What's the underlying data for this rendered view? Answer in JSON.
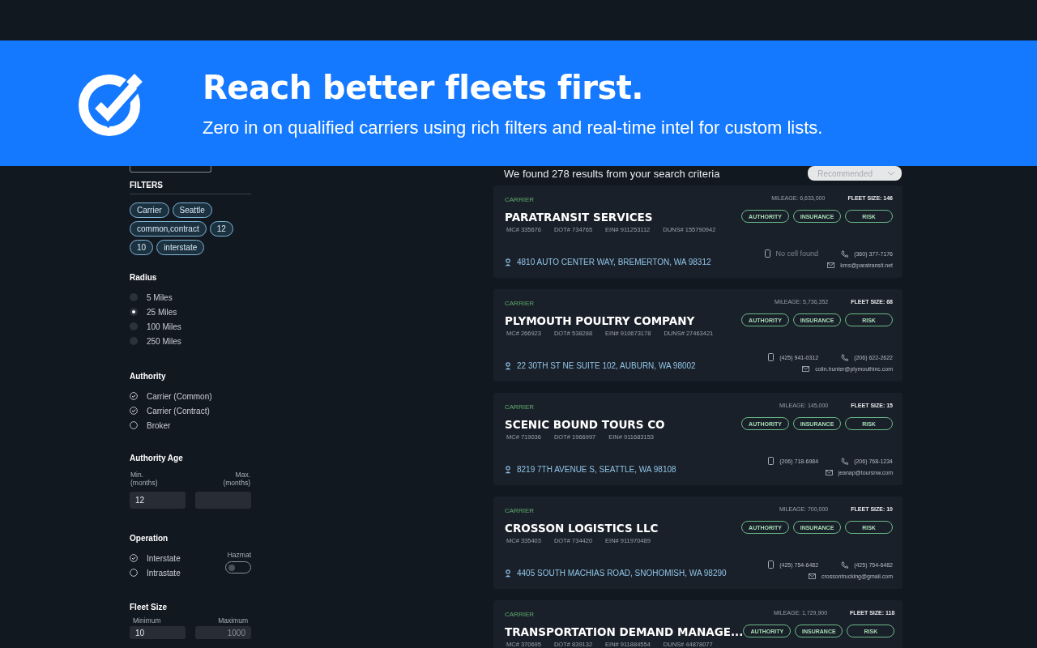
{
  "banner": {
    "title": "Reach better fleets first.",
    "subtitle": "Zero in on qualified carriers using rich filters and real-time intel for custom lists."
  },
  "sidebar": {
    "filters_title": "FILTERS",
    "chips": [
      "Carrier",
      "Seattle",
      "common,contract",
      "12",
      "10",
      "interstate"
    ],
    "radius": {
      "title": "Radius",
      "options": [
        {
          "label": "5 Miles",
          "selected": false
        },
        {
          "label": "25 Miles",
          "selected": true
        },
        {
          "label": "100 Miles",
          "selected": false
        },
        {
          "label": "250 Miles",
          "selected": false
        }
      ]
    },
    "authority": {
      "title": "Authority",
      "options": [
        {
          "label": "Carrier (Common)",
          "checked": true
        },
        {
          "label": "Carrier (Contract)",
          "checked": true
        },
        {
          "label": "Broker",
          "checked": false
        }
      ]
    },
    "authority_age": {
      "title": "Authority Age",
      "min_label": "Min.\n(months)",
      "max_label": "Max.\n(months)",
      "min_value": "12"
    },
    "operation": {
      "title": "Operation",
      "options": [
        {
          "label": "Interstate",
          "checked": true
        },
        {
          "label": "Intrastate",
          "checked": false
        }
      ],
      "hazmat": {
        "label": "Hazmat",
        "on": false
      }
    },
    "fleet_size": {
      "title": "Fleet Size",
      "min_label": "Minimum",
      "max_label": "Maximum",
      "min_value": "10",
      "max_placeholder": "1000"
    }
  },
  "results": {
    "summary": "We found 278 results from your search criteria",
    "sort": "Recommended",
    "cards": [
      {
        "type": "CARRIER",
        "name": "PARATRANSIT SERVICES",
        "ids": [
          "MC# 335676",
          "DOT# 734765",
          "EIN# 911253112",
          "DUNS# 155790942"
        ],
        "mileage": "MILEAGE: 6,633,000",
        "fleet_size": "FLEET SIZE: 146",
        "actions": [
          "AUTHORITY",
          "INSURANCE",
          "RISK"
        ],
        "address": "4810 AUTO CENTER WAY, BREMERTON, WA 98312",
        "cell": "No cell found",
        "cell_found": false,
        "phone": "(360) 377-7176",
        "email": "kms@paratransit.net"
      },
      {
        "type": "CARRIER",
        "name": "PLYMOUTH POULTRY COMPANY",
        "ids": [
          "MC# 266923",
          "DOT# 538288",
          "EIN# 910673178",
          "DUNS# 27463421"
        ],
        "mileage": "MILEAGE: 5,736,352",
        "fleet_size": "FLEET SIZE: 68",
        "actions": [
          "AUTHORITY",
          "INSURANCE",
          "RISK"
        ],
        "address": "22 30TH ST NE SUITE 102, AUBURN, WA 98002",
        "cell": "(425) 941-0312",
        "cell_found": true,
        "phone": "(206) 622-2622",
        "email": "colin.hunter@plymouthinc.com"
      },
      {
        "type": "CARRIER",
        "name": "SCENIC BOUND TOURS CO",
        "ids": [
          "MC# 719036",
          "DOT# 1966997",
          "EIN# 911683153"
        ],
        "mileage": "MILEAGE: 145,000",
        "fleet_size": "FLEET SIZE: 15",
        "actions": [
          "AUTHORITY",
          "INSURANCE",
          "RISK"
        ],
        "address": "8219 7TH AVENUE S, SEATTLE, WA 98108",
        "cell": "(206) 718-6984",
        "cell_found": true,
        "phone": "(206) 768-1234",
        "email": "jeanap@toursnw.com"
      },
      {
        "type": "CARRIER",
        "name": "CROSSON LOGISTICS LLC",
        "ids": [
          "MC# 335403",
          "DOT# 734420",
          "EIN# 911970489"
        ],
        "mileage": "MILEAGE: 700,000",
        "fleet_size": "FLEET SIZE: 10",
        "actions": [
          "AUTHORITY",
          "INSURANCE",
          "RISK"
        ],
        "address": "4405 SOUTH MACHIAS ROAD, SNOHOMISH, WA 98290",
        "cell": "(425) 754-6482",
        "cell_found": true,
        "phone": "(425) 754-6482",
        "email": "crossontrucking@gmail.com"
      },
      {
        "type": "CARRIER",
        "name": "TRANSPORTATION DEMAND MANAGE...",
        "ids": [
          "MC# 370695",
          "DOT# 839132",
          "EIN# 911884554",
          "DUNS# 44878077"
        ],
        "mileage": "MILEAGE: 1,729,900",
        "fleet_size": "FLEET SIZE: 118",
        "actions": [
          "AUTHORITY",
          "INSURANCE",
          "RISK"
        ]
      }
    ]
  }
}
